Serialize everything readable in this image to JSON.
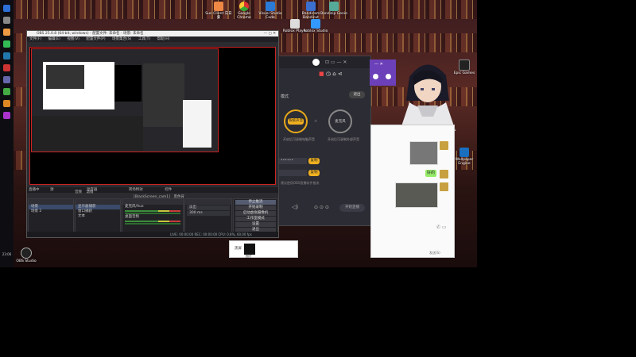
{
  "obs": {
    "title": "OBS 25.0.8 (64-bit, windows) - 配置文件: 未命名 - 场景: 未命名",
    "menu": [
      "文件(F)",
      "编辑(E)",
      "视图(V)",
      "配置文件(P)",
      "场景集合(S)",
      "工具(T)",
      "帮助(H)"
    ],
    "dock_bar": [
      "直播中",
      "源",
      "混音器",
      "转场特效",
      "控件"
    ],
    "filter_bar": [
      "音频",
      "滤镜",
      "[BlackScreen_cam1]",
      "黑色背景"
    ],
    "scenes": [
      "场景",
      "场景 2"
    ],
    "sources": [
      "显示器捕获",
      "窗口捕获",
      "文本"
    ],
    "mixer": [
      "麦克风/Aux",
      "桌面音频"
    ],
    "transitions": {
      "type": "淡出",
      "duration": "300 ms"
    },
    "controls": [
      "停止推流",
      "开始录制",
      "启动虚拟摄像机",
      "工作室模式",
      "设置",
      "退出"
    ],
    "status": "LIVE: 00:00:00   REC: 00:00:00   CPU: 0.8%, 60.00 fps"
  },
  "app": {
    "tab_label": "模式",
    "button_top": "退出",
    "circle_left": "系统声音",
    "circle_right": "麦克风",
    "caption_left": "开启后可录制电脑声音",
    "caption_right": "开启后可录制外部声音",
    "field1": "••••••",
    "field1_btn": "复制",
    "field2_btn": "复制",
    "hint": "建议使用OBS直播软件推流",
    "bottom_btn": "开始直播"
  },
  "chat": {
    "bubble": "好的"
  },
  "popup": {
    "caption": "黑屏",
    "caption2": "图片"
  },
  "desktop_icons": [
    {
      "label": "Sun Client 向日葵"
    },
    {
      "label": "Google Chrome"
    },
    {
      "label": "Visual Studio Code"
    },
    {
      "label": "Bandicam Bandicut"
    },
    {
      "label": "Bandizip Genie"
    },
    {
      "label": "Roblox Player"
    },
    {
      "label": "Roblox Studio"
    },
    {
      "label": "Epic Games"
    },
    {
      "label": "Wallpaper Engine"
    },
    {
      "label": "OBS Studio"
    }
  ],
  "taskbar": {
    "clock": "23:06"
  }
}
